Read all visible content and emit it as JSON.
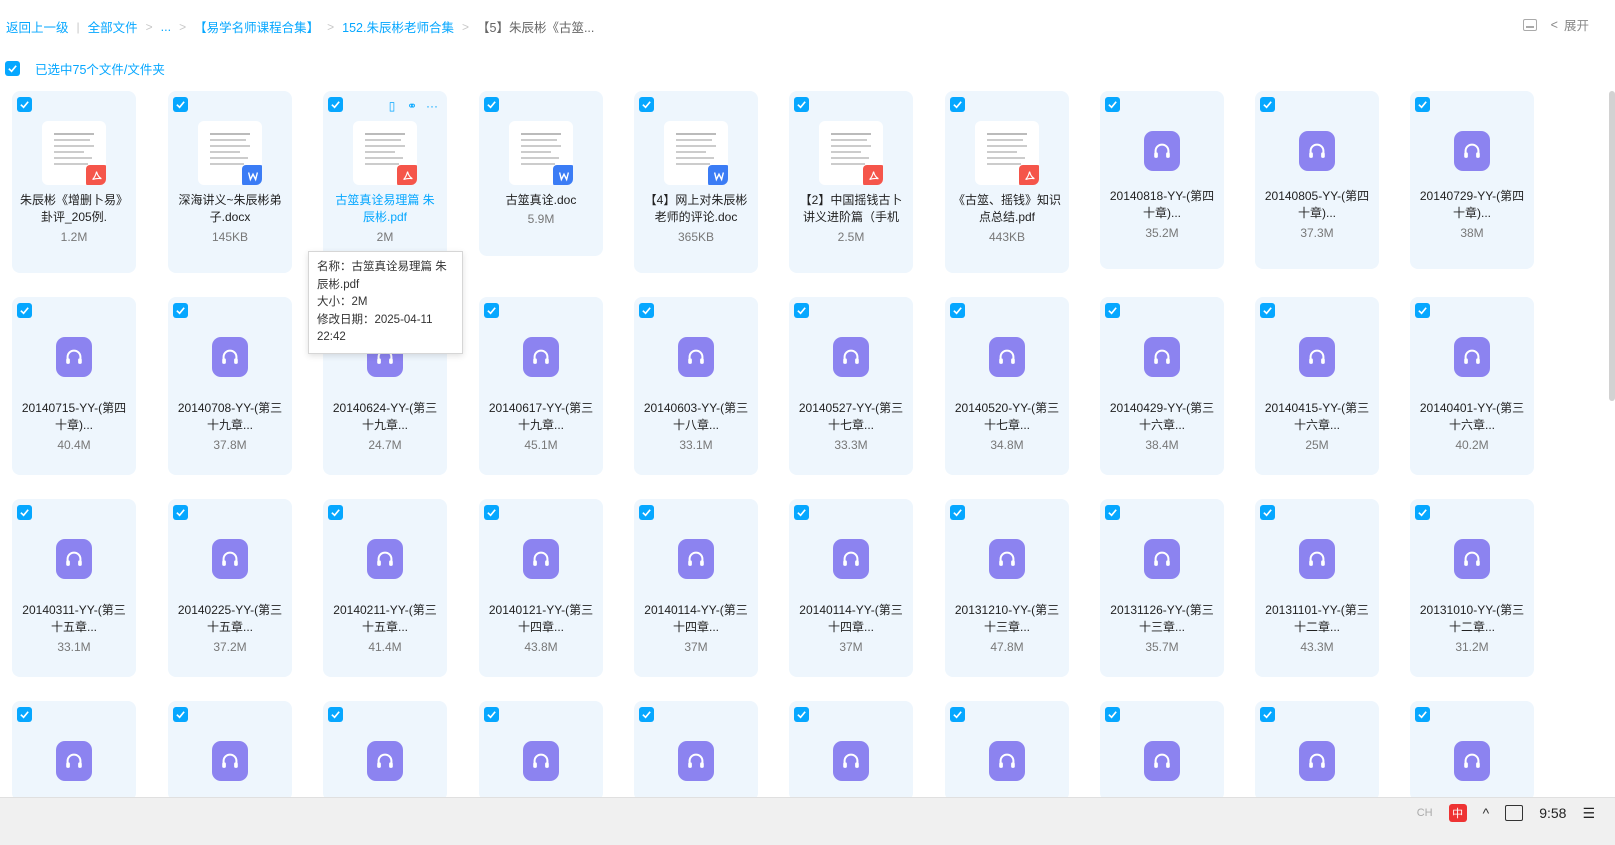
{
  "breadcrumb": {
    "back": "返回上一级",
    "all_files": "全部文件",
    "ellipsis": "...",
    "folder1": "【易学名师课程合集】",
    "folder2": "152.朱辰彬老师合集",
    "current": "【5】朱辰彬《古筮..."
  },
  "top_right": {
    "expand": "展开"
  },
  "selection": {
    "text": "已选中75个文件/文件夹"
  },
  "files": [
    {
      "name": "朱辰彬《增删卜易》卦评_205例.",
      "size": "1.2M",
      "kind": "pdf"
    },
    {
      "name": "深海讲义~朱辰彬弟子.docx",
      "size": "145KB",
      "kind": "word"
    },
    {
      "name": "古筮真诠易理篇 朱辰彬.pdf",
      "size": "2M",
      "kind": "pdf"
    },
    {
      "name": "古筮真诠.doc",
      "size": "5.9M",
      "kind": "word"
    },
    {
      "name": "【4】网上对朱辰彬老师的评论.doc",
      "size": "365KB",
      "kind": "word"
    },
    {
      "name": "【2】中国摇钱古卜讲义进阶篇（手机",
      "size": "2.5M",
      "kind": "pdf"
    },
    {
      "name": "《古筮、摇钱》知识点总结.pdf",
      "size": "443KB",
      "kind": "pdf"
    },
    {
      "name": "20140818-YY-(第四十章)...",
      "size": "35.2M",
      "kind": "audio"
    },
    {
      "name": "20140805-YY-(第四十章)...",
      "size": "37.3M",
      "kind": "audio"
    },
    {
      "name": "20140729-YY-(第四十章)...",
      "size": "38M",
      "kind": "audio"
    },
    {
      "name": "20140715-YY-(第四十章)...",
      "size": "40.4M",
      "kind": "audio"
    },
    {
      "name": "20140708-YY-(第三十九章...",
      "size": "37.8M",
      "kind": "audio"
    },
    {
      "name": "20140624-YY-(第三十九章...",
      "size": "24.7M",
      "kind": "audio"
    },
    {
      "name": "20140617-YY-(第三十九章...",
      "size": "45.1M",
      "kind": "audio"
    },
    {
      "name": "20140603-YY-(第三十八章...",
      "size": "33.1M",
      "kind": "audio"
    },
    {
      "name": "20140527-YY-(第三十七章...",
      "size": "33.3M",
      "kind": "audio"
    },
    {
      "name": "20140520-YY-(第三十七章...",
      "size": "34.8M",
      "kind": "audio"
    },
    {
      "name": "20140429-YY-(第三十六章...",
      "size": "38.4M",
      "kind": "audio"
    },
    {
      "name": "20140415-YY-(第三十六章...",
      "size": "25M",
      "kind": "audio"
    },
    {
      "name": "20140401-YY-(第三十六章...",
      "size": "40.2M",
      "kind": "audio"
    },
    {
      "name": "20140311-YY-(第三十五章...",
      "size": "33.1M",
      "kind": "audio"
    },
    {
      "name": "20140225-YY-(第三十五章...",
      "size": "37.2M",
      "kind": "audio"
    },
    {
      "name": "20140211-YY-(第三十五章...",
      "size": "41.4M",
      "kind": "audio"
    },
    {
      "name": "20140121-YY-(第三十四章...",
      "size": "43.8M",
      "kind": "audio"
    },
    {
      "name": "20140114-YY-(第三十四章...",
      "size": "37M",
      "kind": "audio"
    },
    {
      "name": "20140114-YY-(第三十四章...",
      "size": "37M",
      "kind": "audio"
    },
    {
      "name": "20131210-YY-(第三十三章...",
      "size": "47.8M",
      "kind": "audio"
    },
    {
      "name": "20131126-YY-(第三十三章...",
      "size": "35.7M",
      "kind": "audio"
    },
    {
      "name": "20131101-YY-(第三十二章...",
      "size": "43.3M",
      "kind": "audio"
    },
    {
      "name": "20131010-YY-(第三十二章...",
      "size": "31.2M",
      "kind": "audio"
    },
    {
      "name": "",
      "size": "",
      "kind": "audio"
    },
    {
      "name": "",
      "size": "",
      "kind": "audio"
    },
    {
      "name": "",
      "size": "",
      "kind": "audio"
    },
    {
      "name": "",
      "size": "",
      "kind": "audio"
    },
    {
      "name": "",
      "size": "",
      "kind": "audio"
    },
    {
      "name": "",
      "size": "",
      "kind": "audio"
    },
    {
      "name": "",
      "size": "",
      "kind": "audio"
    },
    {
      "name": "",
      "size": "",
      "kind": "audio"
    },
    {
      "name": "",
      "size": "",
      "kind": "audio"
    },
    {
      "name": "",
      "size": "",
      "kind": "audio"
    }
  ],
  "tooltip": {
    "name": "名称：古筮真诠易理篇 朱辰彬.pdf",
    "size": "大小：2M",
    "date": "修改日期：2025-04-11 22:42"
  },
  "taskbar": {
    "lang": "CH",
    "ime": "中",
    "time": "9:58"
  },
  "colors": {
    "accent": "#06a7ff",
    "audio": "#8c83f0",
    "pdf": "#f5554a",
    "word": "#3b7cf5",
    "tile": "#eef6fd"
  }
}
